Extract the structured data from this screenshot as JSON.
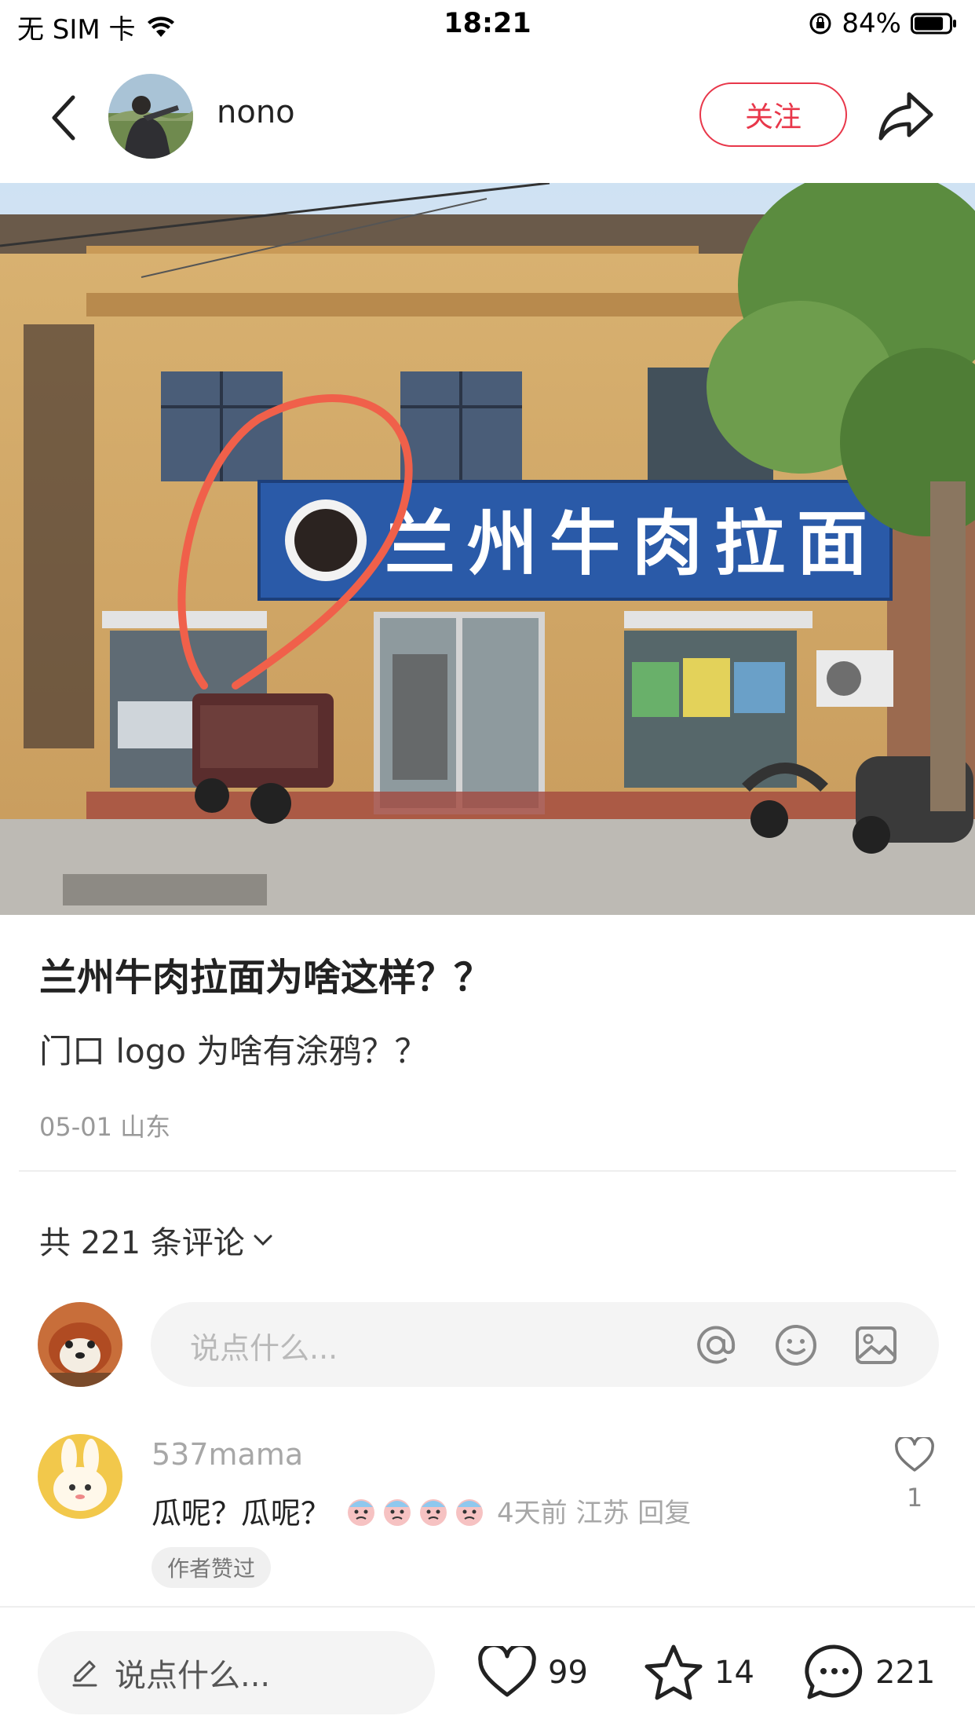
{
  "status_bar": {
    "carrier": "无 SIM 卡",
    "time": "18:21",
    "battery_pct": "84%",
    "battery_level": 0.84
  },
  "header": {
    "author_name": "nono",
    "follow_label": "关注",
    "accent_color": "#e8374a"
  },
  "photo": {
    "sign_text": [
      "兰",
      "州",
      "牛",
      "肉",
      "拉",
      "面"
    ]
  },
  "post": {
    "title": "兰州牛肉拉面为啥这样？？",
    "body": "门口 logo 为啥有涂鸦？？",
    "meta": "05-01 山东"
  },
  "comments": {
    "count_label": "共 221 条评论",
    "input_placeholder": "说点什么...",
    "items": [
      {
        "user": "537mama",
        "text": "瓜呢？瓜呢？",
        "emoji_count": 4,
        "time": "4天前 江苏 回复",
        "likes": "1",
        "badge": "作者赞过"
      }
    ]
  },
  "bottom_bar": {
    "input_placeholder": "说点什么...",
    "likes": "99",
    "favorites": "14",
    "comments": "221"
  }
}
